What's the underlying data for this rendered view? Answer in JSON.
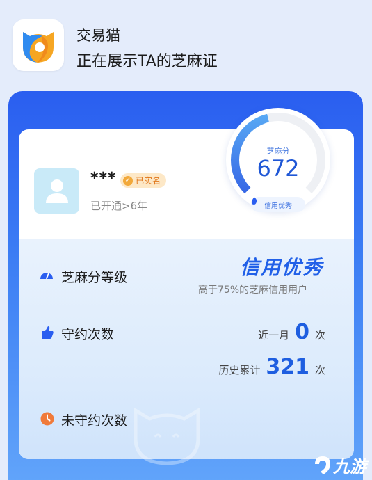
{
  "header": {
    "app_name": "交易猫",
    "subtitle": "正在展示TA的芝麻证",
    "logo_icon": "jiaoyimao-cat-logo"
  },
  "user": {
    "name": "***",
    "verified_label": "已实名",
    "open_years": "已开通>6年",
    "avatar_icon": "default-person-icon"
  },
  "gauge": {
    "label": "芝麻分",
    "score": "672",
    "score_fraction": 0.45,
    "badge": "信用优秀"
  },
  "level": {
    "label": "芝麻分等级",
    "value": "信用优秀",
    "desc": "高于75%的芝麻信用用户"
  },
  "kept": {
    "label": "守约次数",
    "recent_prefix": "近一月",
    "recent_count": "0",
    "recent_unit": "次",
    "total_prefix": "历史累计",
    "total_count": "321",
    "total_unit": "次"
  },
  "broken": {
    "label": "未守约次数"
  },
  "watermark": {
    "text": "九游"
  },
  "colors": {
    "accent": "#2160e8",
    "card_top": "#2a5ef0",
    "card_bottom": "#62a5fa",
    "badge_bg": "#fde8c7",
    "badge_text": "#e0761a",
    "clock_orange": "#f07a3a"
  }
}
